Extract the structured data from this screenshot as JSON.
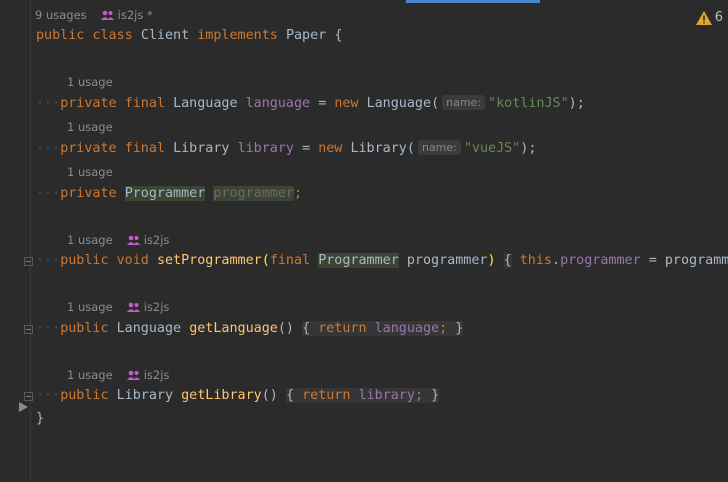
{
  "top_hint": {
    "usages": "9 usages",
    "author": "is2js *"
  },
  "warning": {
    "count": "6",
    "color": "#e2a72a"
  },
  "class_decl": {
    "public": "public",
    "class": "class",
    "name": "Client",
    "implements": "implements",
    "iface": "Paper",
    "brace": "{"
  },
  "field1": {
    "usage": "1 usage",
    "private": "private",
    "final": "final",
    "type": "Language",
    "name": "language",
    "eq": "=",
    "new": "new",
    "ctor": "Language",
    "open": "(",
    "hint": "name:",
    "value": "\"kotlinJS\"",
    "close": ");"
  },
  "field2": {
    "usage": "1 usage",
    "private": "private",
    "final": "final",
    "type": "Library",
    "name": "library",
    "eq": "=",
    "new": "new",
    "ctor": "Library",
    "open": "(",
    "hint": "name:",
    "value": "\"vueJS\"",
    "close": ");"
  },
  "field3": {
    "usage": "1 usage",
    "private": "private",
    "type": "Programmer",
    "name": "programmer",
    "semi": ";"
  },
  "method1": {
    "usage": "1 usage",
    "author": "is2js",
    "public": "public",
    "ret": "void",
    "name": "setProgrammer",
    "open": "(",
    "final": "final",
    "ptype": "Programmer",
    "pname": "programmer",
    "close": ")",
    "lbrace": "{",
    "this": "this",
    "dot": ".",
    "field": "programmer",
    "eq": "=",
    "rest": "programm"
  },
  "method2": {
    "usage": "1 usage",
    "author": "is2js",
    "public": "public",
    "ret": "Language",
    "name": "getLanguage",
    "parens": "()",
    "lbrace": "{",
    "return": "return",
    "field": "language",
    "semi": ";",
    "rbrace": "}"
  },
  "method3": {
    "usage": "1 usage",
    "author": "is2js",
    "public": "public",
    "ret": "Library",
    "name": "getLibrary",
    "parens": "()",
    "lbrace": "{",
    "return": "return",
    "field": "library",
    "semi": ";",
    "rbrace": "}"
  },
  "class_close": "}",
  "icons": {
    "people": "people-icon",
    "warning": "warning-triangle-icon",
    "fold": "fold-marker-icon",
    "run": "run-gutter-icon"
  }
}
